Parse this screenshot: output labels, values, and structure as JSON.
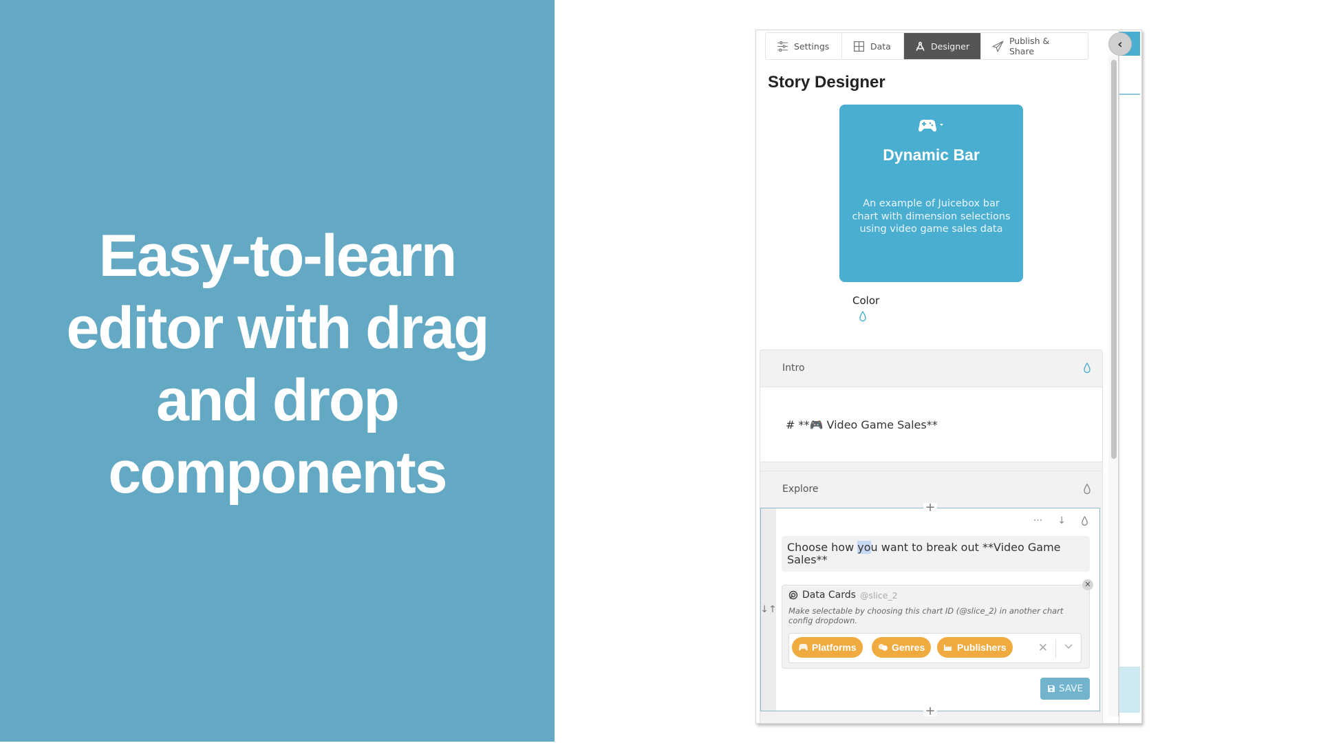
{
  "hero": {
    "headline": "Easy-to-learn editor with drag and drop components",
    "background": "#63a9c3"
  },
  "tabs": [
    {
      "label": "Settings",
      "icon": "sliders-icon",
      "active": false
    },
    {
      "label": "Data",
      "icon": "table-grid-icon",
      "active": false
    },
    {
      "label": "Designer",
      "icon": "compass-drafting-icon",
      "active": true
    },
    {
      "label": "Publish & Share",
      "icon": "paper-plane-icon",
      "active": false
    }
  ],
  "collapse_button": {
    "icon": "chevron-left-icon",
    "glyph": "‹"
  },
  "page_title": "Story Designer",
  "story_card": {
    "icon": "gamepad-icon",
    "title": "Dynamic Bar",
    "description": "An example of Juicebox bar chart with dimension selections using video game sales data",
    "color": "#4aaed0"
  },
  "color_picker": {
    "label": "Color",
    "icon": "droplet-icon"
  },
  "sections": {
    "intro": {
      "label": "Intro",
      "content": "# **🎮 Video Game Sales**"
    },
    "explore": {
      "label": "Explore",
      "tools": {
        "more": "···",
        "move_down": "↓"
      },
      "text_before": "Choose how ",
      "text_highlight": "yo",
      "text_after": "u want to break out **Video Game Sales**",
      "drag_handle": "↓↑",
      "data_cards": {
        "title": "Data Cards",
        "slice_id": "@slice_2",
        "description": "Make selectable by choosing this chart ID (@slice_2) in another chart config dropdown.",
        "selected": [
          {
            "label": "Platforms",
            "icon": "gamepad-icon"
          },
          {
            "label": "Genres",
            "icon": "theater-masks-icon"
          },
          {
            "label": "Publishers",
            "icon": "industry-icon"
          }
        ],
        "pill_color": "#efab3f",
        "clear": "✕"
      },
      "save_label": "SAVE",
      "add_label": "+"
    }
  }
}
